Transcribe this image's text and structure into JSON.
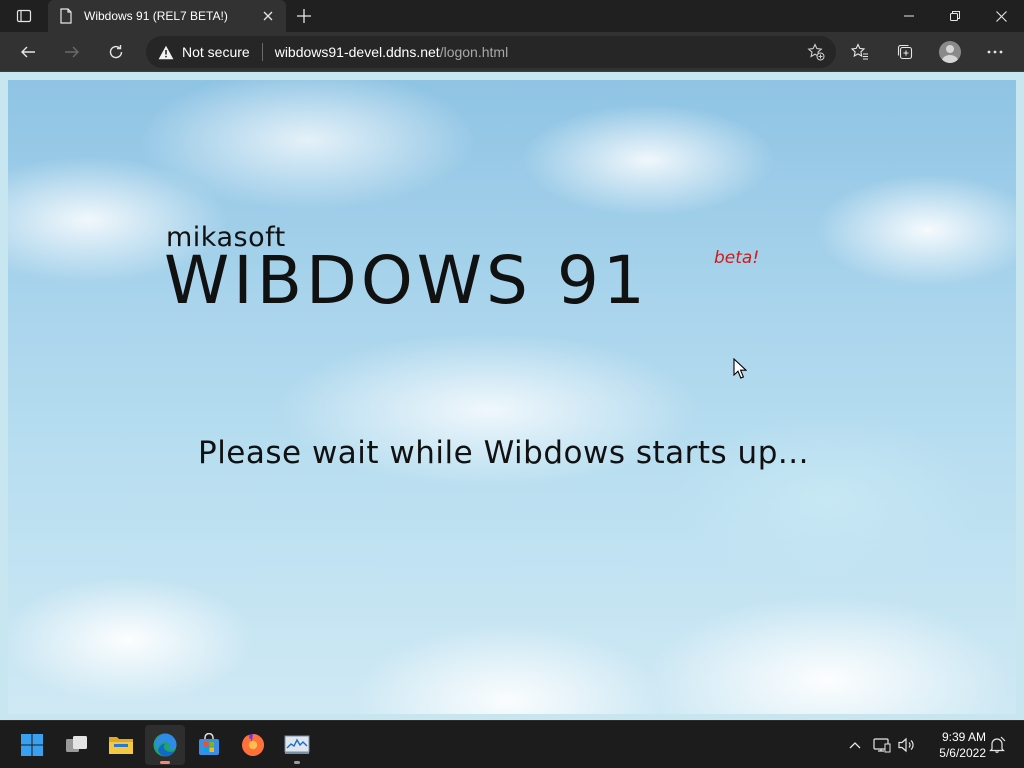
{
  "browser": {
    "tab_title": "Wibdows 91 (REL7 BETA!)",
    "security_label": "Not secure",
    "url_host": "wibdows91-devel.ddns.net",
    "url_path": "/logon.html"
  },
  "page": {
    "company_name": "mikasoft",
    "product_name": "WIBDOWS 91",
    "beta_label": "beta!",
    "status_message": "Please wait while Wibdows starts up...",
    "beta_color": "#d11a1a"
  },
  "taskbar": {
    "apps": [
      "start",
      "task-view",
      "file-explorer",
      "edge",
      "store",
      "firefox",
      "task-manager"
    ],
    "time": "9:39 AM",
    "date": "5/6/2022"
  }
}
